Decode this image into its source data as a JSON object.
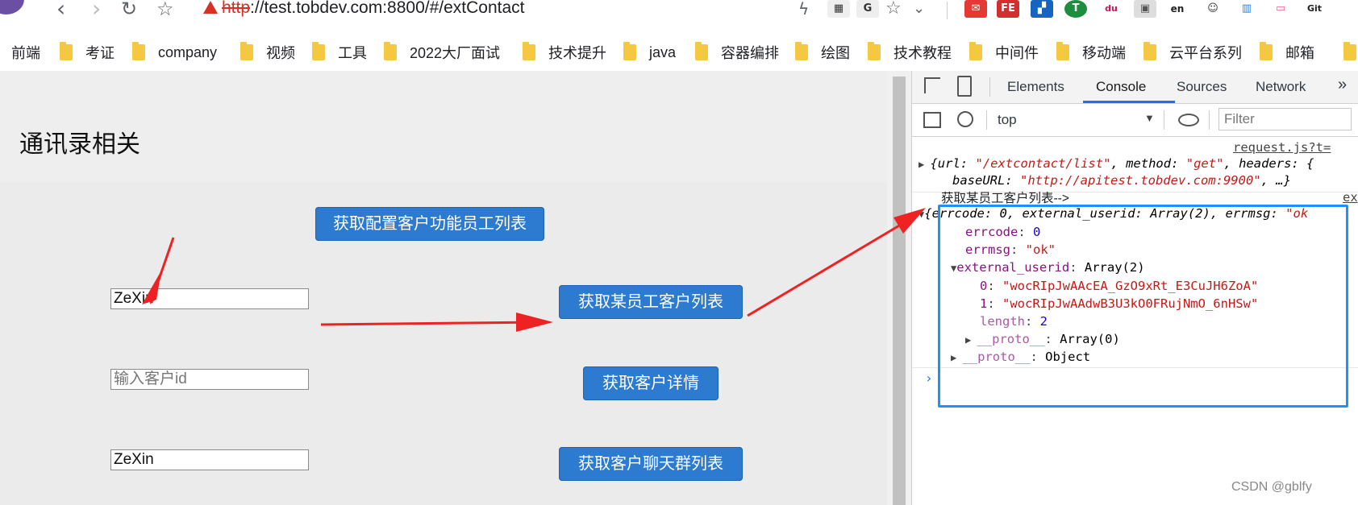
{
  "browser": {
    "url_scheme": "http",
    "url_rest": "://test.tobdev.com:8800/#/extContact",
    "extensions": [
      "ext-zip",
      "ext-mail",
      "ext-fe",
      "ext-apps",
      "ext-t",
      "ext-du",
      "ext-save",
      "ext-en",
      "ext-face",
      "ext-db",
      "ext-bili",
      "ext-gitzip"
    ],
    "ext_labels": {
      "fe": "FE",
      "t": "T",
      "du": "du",
      "en": "en",
      "git": "Git"
    }
  },
  "bookmarks": [
    "前端",
    "考证",
    "company",
    "视频",
    "工具",
    "2022大厂面试",
    "技术提升",
    "java",
    "容器编排",
    "绘图",
    "技术教程",
    "中间件",
    "移动端",
    "云平台系列",
    "邮箱"
  ],
  "page": {
    "title": "通讯录相关",
    "btn_config": "获取配置客户功能员工列表",
    "input1_value": "ZeXin",
    "btn_employee_customers": "获取某员工客户列表",
    "input2_placeholder": "输入客户id",
    "btn_customer_detail": "获取客户详情",
    "input3_value": "ZeXin",
    "btn_group_chats": "获取客户聊天群列表"
  },
  "devtools": {
    "tabs": [
      "Elements",
      "Console",
      "Sources",
      "Network"
    ],
    "active_tab": "Console",
    "context": "top",
    "filter_placeholder": "Filter",
    "source_link": "request.js?t=",
    "req_line1_a": "{url: ",
    "req_url": "\"/extcontact/list\"",
    "req_line1_b": ", method: ",
    "req_method": "\"get\"",
    "req_line1_c": ", headers: {",
    "req_line2_a": "baseURL: ",
    "req_baseurl": "\"http://apitest.tobdev.com:9900\"",
    "req_line2_b": ", …}",
    "log_label": "获取某员工客户列表-->",
    "log_link": "ex",
    "obj_summary_a": "{errcode: 0, external_userid: Array(2), errmsg: ",
    "obj_summary_b": "\"ok",
    "errcode_key": "errcode",
    "errcode_val": "0",
    "errmsg_key": "errmsg",
    "errmsg_val": "\"ok\"",
    "ext_key": "external_userid",
    "ext_val": "Array(2)",
    "id0_key": "0",
    "id0_val": "\"wocRIpJwAAcEA_GzO9xRt_E3CuJH6ZoA\"",
    "id1_key": "1",
    "id1_val": "\"wocRIpJwAAdwB3U3kO0FRujNmO_6nHSw\"",
    "length_key": "length",
    "length_val": "2",
    "proto_key": "__proto__",
    "proto_arr_val": "Array(0)",
    "proto_obj_val": "Object"
  },
  "watermark": "CSDN @gblfy",
  "colors": {
    "button": "#2d7bd1",
    "arrow": "#ee2222",
    "highlight": "#1e90ff"
  }
}
